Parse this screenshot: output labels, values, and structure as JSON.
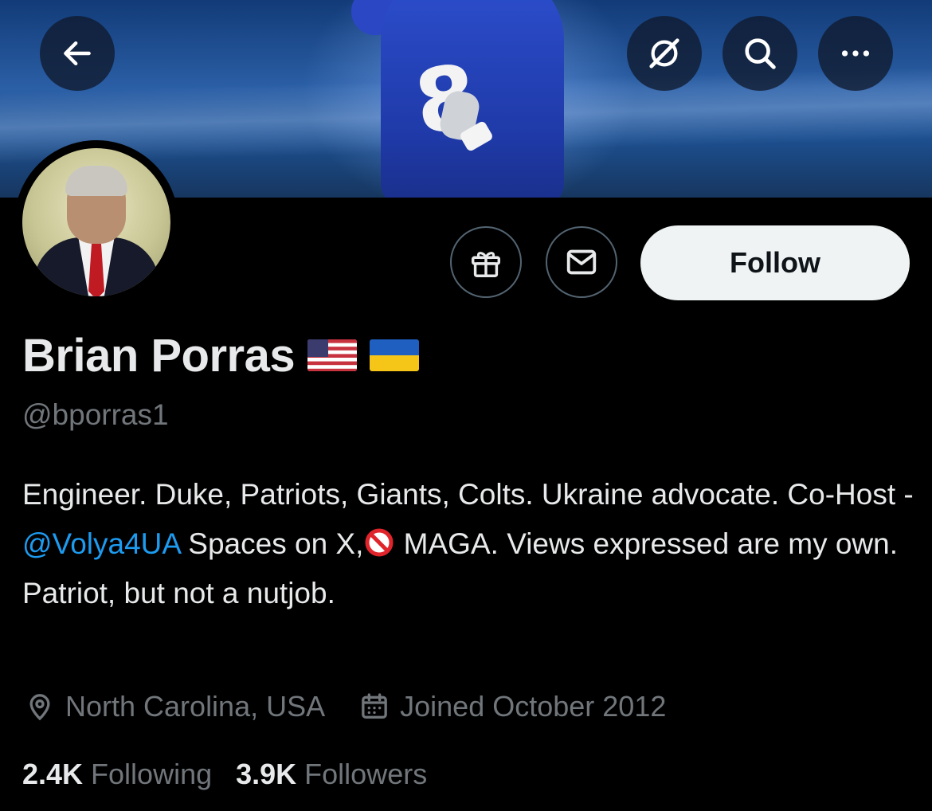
{
  "banner": {
    "jersey_number": "8",
    "colors": {
      "sky": "#2b5fa6",
      "jersey": "#1f3aa8"
    }
  },
  "top_bar": {
    "back_icon": "arrow-left-icon",
    "grok_icon": "slashed-circle-icon",
    "search_icon": "search-icon",
    "more_icon": "more-horizontal-icon"
  },
  "actions": {
    "gift_icon": "gift-icon",
    "message_icon": "envelope-icon",
    "follow_label": "Follow"
  },
  "profile": {
    "name": "Brian Porras",
    "flags": [
      "us-flag",
      "ukraine-flag"
    ],
    "handle": "@bporras1",
    "bio": {
      "part1": "Engineer. Duke, Patriots, Giants, Colts. Ukraine advocate. Co-Host - ",
      "mention": "@Volya4UA",
      "part2": " Spaces on X,",
      "part3": " MAGA. Views expressed are my own. Patriot, but not a nutjob."
    },
    "location": "North Carolina, USA",
    "joined": "Joined October 2012"
  },
  "stats": {
    "following_count": "2.4K",
    "following_label": "Following",
    "followers_count": "3.9K",
    "followers_label": "Followers"
  },
  "colors": {
    "background": "#000000",
    "text": "#e7e9ea",
    "muted": "#71767b",
    "link": "#1d9bf0",
    "border": "#536471",
    "follow_bg": "#eff3f4"
  }
}
